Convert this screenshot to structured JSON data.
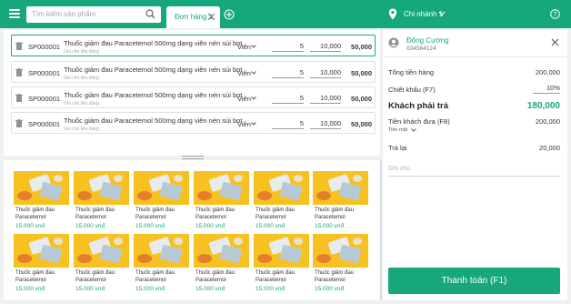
{
  "topbar": {
    "search_placeholder": "Tìm kiếm sản phẩm",
    "tab_label": "Đơn hàng 1",
    "branch": "Chi nhánh 1",
    "accent": "#17a77d"
  },
  "cart": {
    "rows": [
      {
        "code": "SP000001",
        "name": "Thuốc giảm đau Paracetemol 500mg dạng viên nén sủi bọt",
        "note": "Ghi chú liều dùng",
        "unit": "Viên",
        "qty": "5",
        "price": "10,000",
        "total": "50,000"
      },
      {
        "code": "SP000001",
        "name": "Thuốc giảm đau Paracetemol 500mg dạng viên nén sủi bọt",
        "note": "Ghi chú liều dùng",
        "unit": "Viên",
        "qty": "5",
        "price": "10,000",
        "total": "50,000"
      },
      {
        "code": "SP000001",
        "name": "Thuốc giảm đau Paracetemol 500mg dạng viên nén sủi bọt",
        "note": "Ghi chú liều dùng",
        "unit": "Viên",
        "qty": "5",
        "price": "10,000",
        "total": "50,000"
      },
      {
        "code": "SP000001",
        "name": "Thuốc giảm đau Paracetemol 500mg dạng viên nén sủi bọt",
        "note": "Ghi chú liều dùng",
        "unit": "Viên",
        "qty": "5",
        "price": "10,000",
        "total": "50,000"
      }
    ]
  },
  "products": [
    {
      "name": "Thuốc giảm đau Paracetemol 500mg...",
      "price": "15.000 vnđ"
    },
    {
      "name": "Thuốc giảm đau Paracetemol 500mg...",
      "price": "15.000 vnđ"
    },
    {
      "name": "Thuốc giảm đau Paracetemol 500mg...",
      "price": "15.000 vnđ"
    },
    {
      "name": "Thuốc giảm đau Paracetemol 500mg...",
      "price": "15.000 vnđ"
    },
    {
      "name": "Thuốc giảm đau Paracetemol 500mg...",
      "price": "15.000 vnđ"
    },
    {
      "name": "Thuốc giảm đau Paracetemol 500mg...",
      "price": "15.000 vnđ"
    },
    {
      "name": "Thuốc giảm đau Paracetemol 500mg...",
      "price": "15.000 vnđ"
    },
    {
      "name": "Thuốc giảm đau Paracetemol 500mg...",
      "price": "15.000 vnđ"
    },
    {
      "name": "Thuốc giảm đau Paracetemol 500mg...",
      "price": "15.000 vnđ"
    },
    {
      "name": "Thuốc giảm đau Paracetemol 500mg...",
      "price": "15.000 vnđ"
    },
    {
      "name": "Thuốc giảm đau Paracetemol 500mg...",
      "price": "15.000 vnđ"
    },
    {
      "name": "Thuốc giảm đau Paracetemol 500mg...",
      "price": "15.000 vnđ"
    }
  ],
  "panel": {
    "customer_name": "Đông Cường",
    "customer_phone": "034564124",
    "subtotal_label": "Tổng tiền hàng",
    "subtotal_value": "200,000",
    "discount_label": "Chiết khấu (F7)",
    "discount_value": "10%",
    "payable_label": "Khách phải trả",
    "payable_value": "180,000",
    "paid_label": "Tiền khách đưa (F8)",
    "paid_value": "200,000",
    "pay_method": "Tiền mặt",
    "change_label": "Trả lại",
    "change_value": "20,000",
    "note_placeholder": "Ghi chú",
    "pay_button": "Thanh toán (F1)"
  }
}
